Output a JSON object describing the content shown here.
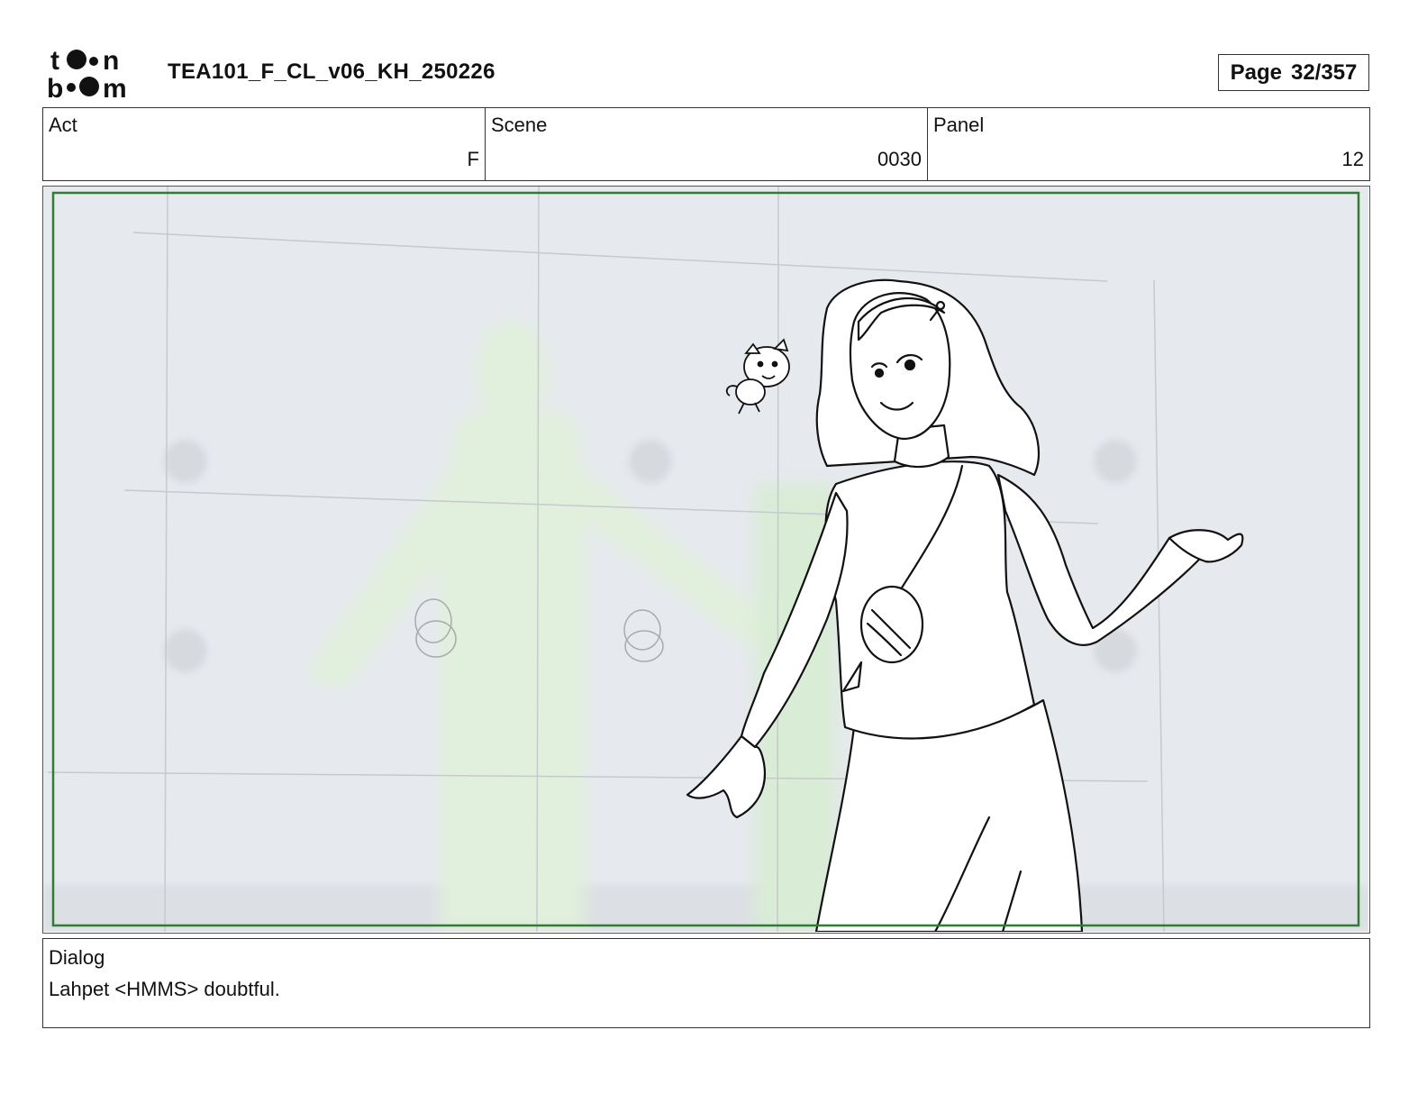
{
  "header": {
    "logo_top": "to●n",
    "logo_bottom": "b●●m",
    "title": "TEA101_F_CL_v06_KH_250226",
    "page_label": "Page",
    "page_number": "32/357"
  },
  "info": {
    "act_label": "Act",
    "act_value": "F",
    "scene_label": "Scene",
    "scene_value": "0030",
    "panel_label": "Panel",
    "panel_value": "12"
  },
  "panel": {
    "frame_color": "#2e7d32",
    "background_color": "#e6e9ee",
    "glow_color": "#dff0dc",
    "icons": [
      "woman-figure-icon",
      "small-flying-creature-icon",
      "glowing-humanoid-silhouette-icon"
    ]
  },
  "dialog": {
    "label": "Dialog",
    "text": "Lahpet <HMMS> doubtful."
  }
}
